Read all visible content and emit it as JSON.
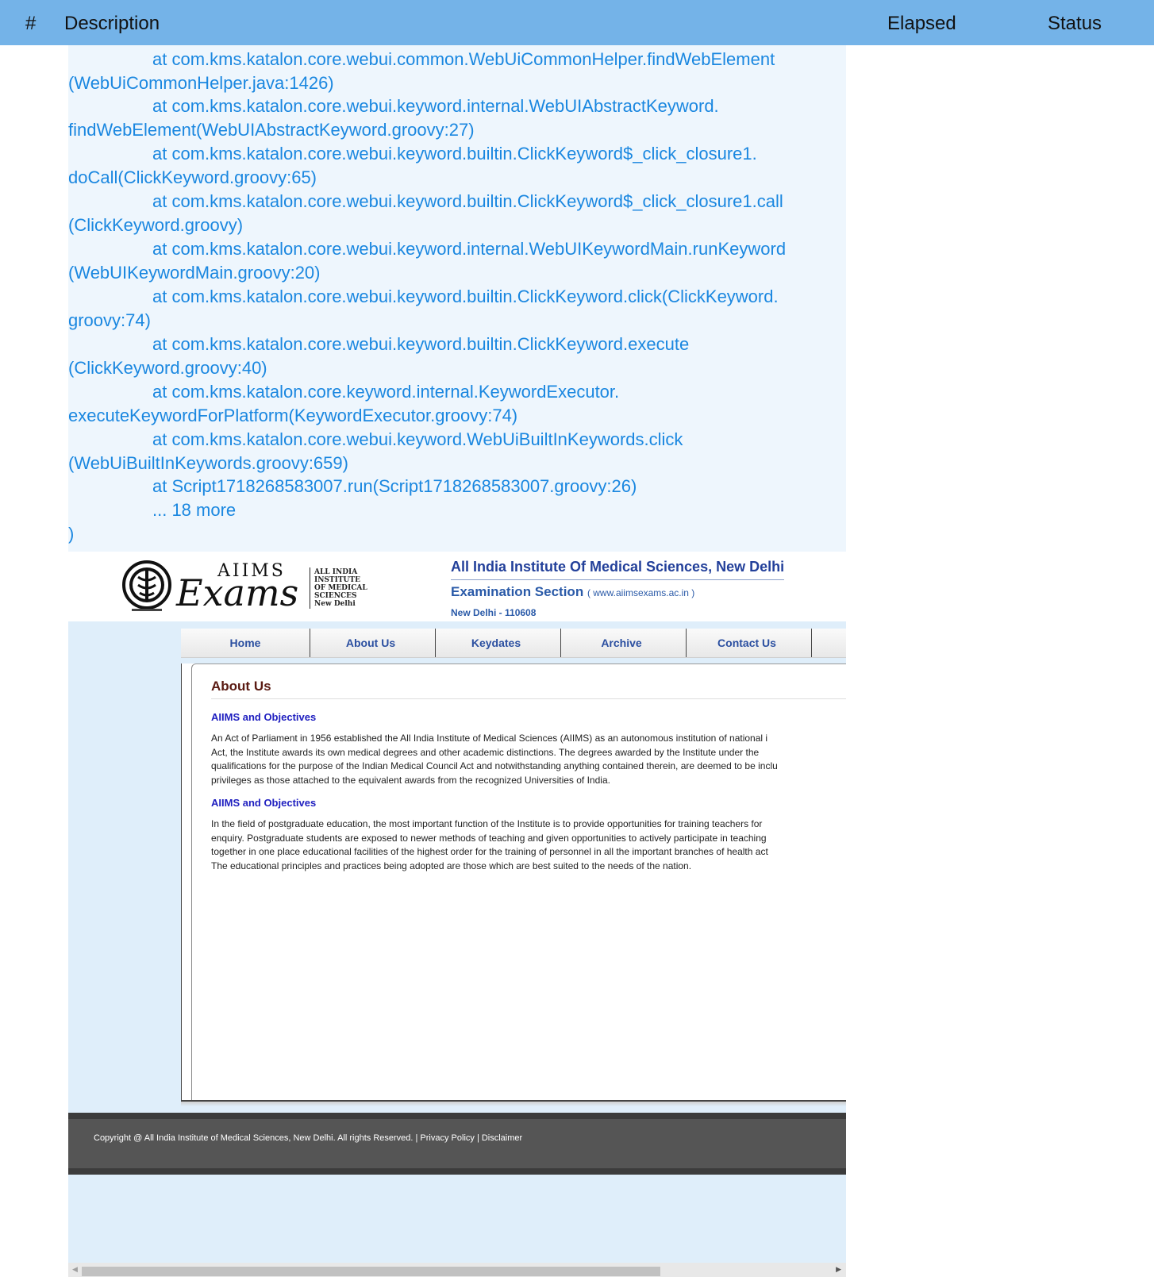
{
  "report_header": {
    "num": "#",
    "description": "Description",
    "elapsed": "Elapsed",
    "status": "Status"
  },
  "trace_lines": [
    "at com.kms.katalon.core.webui.common.WebUiCommonHelper.findWebElement",
    "(WebUiCommonHelper.java:1426)",
    "at com.kms.katalon.core.webui.keyword.internal.WebUIAbstractKeyword.",
    "findWebElement(WebUIAbstractKeyword.groovy:27)",
    "at com.kms.katalon.core.webui.keyword.builtin.ClickKeyword$_click_closure1.",
    "doCall(ClickKeyword.groovy:65)",
    "at com.kms.katalon.core.webui.keyword.builtin.ClickKeyword$_click_closure1.call",
    "(ClickKeyword.groovy)",
    "at com.kms.katalon.core.webui.keyword.internal.WebUIKeywordMain.runKeyword",
    "(WebUIKeywordMain.groovy:20)",
    "at com.kms.katalon.core.webui.keyword.builtin.ClickKeyword.click(ClickKeyword.",
    "groovy:74)",
    "at com.kms.katalon.core.webui.keyword.builtin.ClickKeyword.execute",
    "(ClickKeyword.groovy:40)",
    "at com.kms.katalon.core.keyword.internal.KeywordExecutor.",
    "executeKeywordForPlatform(KeywordExecutor.groovy:74)",
    "at com.kms.katalon.core.webui.keyword.WebUiBuiltInKeywords.click",
    "(WebUiBuiltInKeywords.groovy:659)",
    "at Script1718268583007.run(Script1718268583007.groovy:26)",
    "... 18 more",
    ")"
  ],
  "site": {
    "logo": {
      "aiims": "AIIMS",
      "exams": "Exams",
      "inst_lines": [
        "ALL INDIA",
        "INSTITUTE",
        "OF MEDICAL",
        "SCIENCES",
        "New Delhi"
      ]
    },
    "title": "All India Institute Of Medical Sciences, New Delhi",
    "section": "Examination Section",
    "url": "( www.aiimsexams.ac.in )",
    "city": "New Delhi - 110608",
    "nav": [
      "Home",
      "About Us",
      "Keydates",
      "Archive",
      "Contact Us"
    ],
    "page_title": "About Us",
    "sections": [
      {
        "heading": "AIIMS and Objectives",
        "lines": [
          "An Act of Parliament in 1956 established the All India Institute of Medical Sciences (AIIMS) as an autonomous institution of national i",
          "Act, the Institute awards its own medical degrees and other academic distinctions. The degrees awarded by the Institute under the",
          "qualifications for the purpose of the Indian Medical Council Act and notwithstanding anything contained therein, are deemed to be inclu",
          "privileges as those attached to the equivalent awards from the recognized Universities of India."
        ]
      },
      {
        "heading": "AIIMS and Objectives",
        "lines": [
          "In the field of postgraduate education, the most important function of the Institute is to provide opportunities for training teachers for",
          "enquiry. Postgraduate students are exposed to newer methods of teaching and given opportunities to actively participate in teaching",
          "together in one place educational facilities of the highest order for the training of personnel in all the important branches of health act",
          "The educational principles and practices being adopted are those which are best suited to the needs of the nation."
        ]
      }
    ],
    "footer": "Copyright @ All India Institute of Medical Sciences, New Delhi. All rights Reserved.  |  Privacy Policy  |  Disclaimer",
    "scrollbar_position": 0.77
  }
}
